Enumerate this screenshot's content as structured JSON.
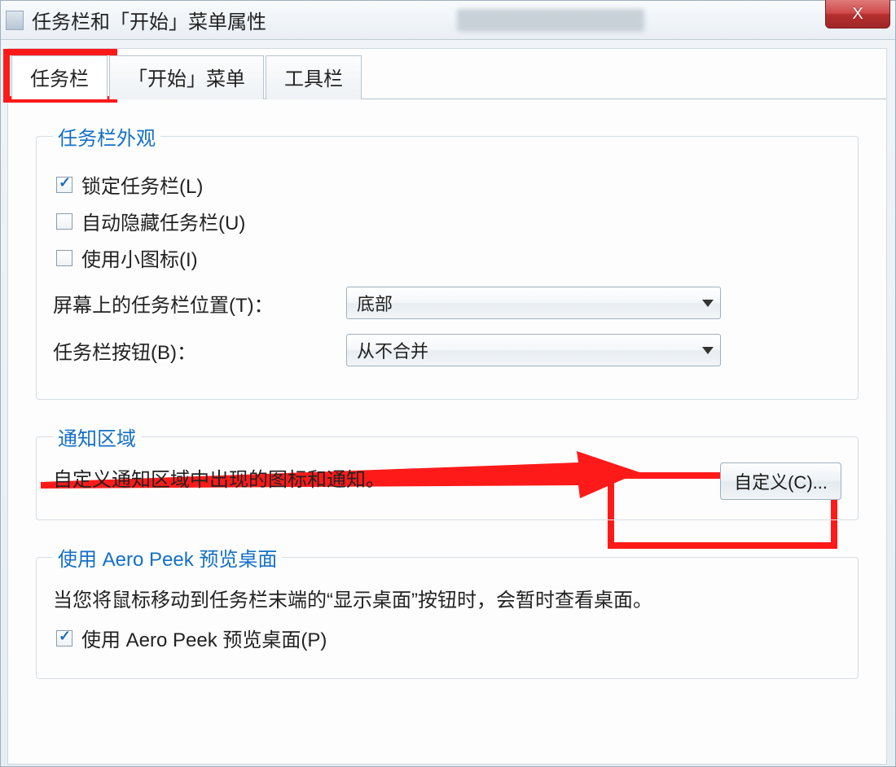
{
  "window": {
    "title": "任务栏和「开始」菜单属性",
    "close_label": "X"
  },
  "tabs": {
    "items": [
      "任务栏",
      "「开始」菜单",
      "工具栏"
    ],
    "active_index": 0
  },
  "appearance": {
    "legend": "任务栏外观",
    "lock_label": "锁定任务栏(L)",
    "lock_checked": true,
    "autohide_label": "自动隐藏任务栏(U)",
    "autohide_checked": false,
    "smallicons_label": "使用小图标(I)",
    "smallicons_checked": false,
    "position_label": "屏幕上的任务栏位置(T)：",
    "position_value": "底部",
    "buttons_label": "任务栏按钮(B)：",
    "buttons_value": "从不合并"
  },
  "notify": {
    "legend": "通知区域",
    "desc": "自定义通知区域中出现的图标和通知。",
    "customize_label": "自定义(C)..."
  },
  "aero": {
    "legend": "使用 Aero Peek 预览桌面",
    "desc": "当您将鼠标移动到任务栏末端的“显示桌面”按钮时，会暂时查看桌面。",
    "check_label": "使用 Aero Peek 预览桌面(P)",
    "check_checked": true
  }
}
